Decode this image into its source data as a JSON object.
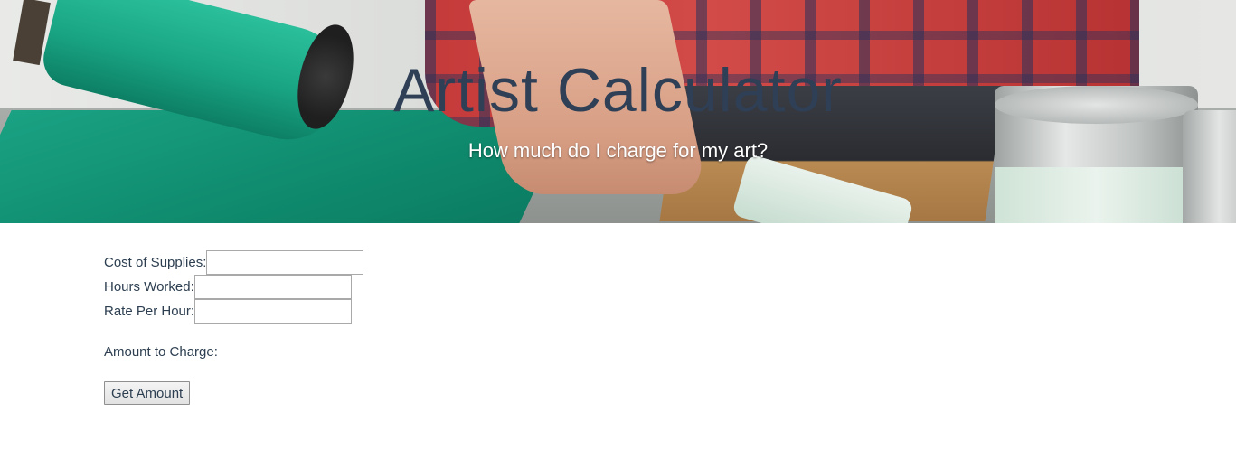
{
  "header": {
    "title": "Artist Calculator",
    "subtitle": "How much do I charge for my art?"
  },
  "form": {
    "supplies_label": "Cost of Supplies:",
    "supplies_value": "",
    "hours_label": "Hours Worked:",
    "hours_value": "",
    "rate_label": "Rate Per Hour:",
    "rate_value": "",
    "result_label": "Amount to Charge:",
    "result_value": "",
    "submit_label": "Get Amount"
  },
  "colors": {
    "title": "#2f3f56",
    "text": "#2c3e50",
    "subtitle": "#ffffff"
  }
}
